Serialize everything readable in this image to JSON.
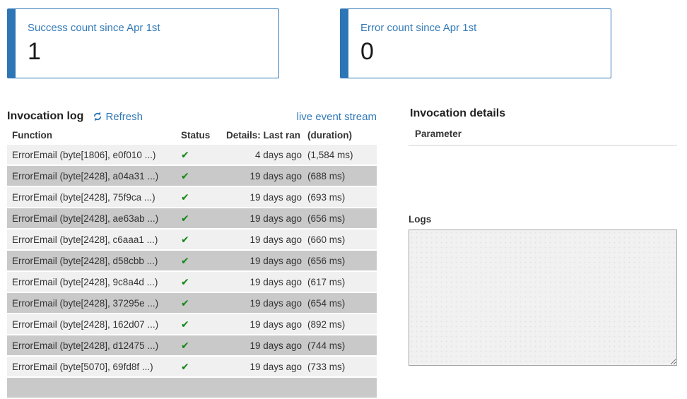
{
  "cards": [
    {
      "label": "Success count since Apr 1st",
      "value": "1"
    },
    {
      "label": "Error count since Apr 1st",
      "value": "0"
    }
  ],
  "log": {
    "title": "Invocation log",
    "refresh_label": "Refresh",
    "live_link_label": "live event stream",
    "columns": {
      "function": "Function",
      "status": "Status",
      "last_ran": "Details: Last ran",
      "duration": "(duration)"
    },
    "status_glyph": "✔",
    "rows": [
      {
        "function": "ErrorEmail (byte[1806], e0f010 ...)",
        "status": "success",
        "last_ran": "4 days ago",
        "duration": "(1,584 ms)"
      },
      {
        "function": "ErrorEmail (byte[2428], a04a31 ...)",
        "status": "success",
        "last_ran": "19 days ago",
        "duration": "(688 ms)"
      },
      {
        "function": "ErrorEmail (byte[2428], 75f9ca ...)",
        "status": "success",
        "last_ran": "19 days ago",
        "duration": "(693 ms)"
      },
      {
        "function": "ErrorEmail (byte[2428], ae63ab ...)",
        "status": "success",
        "last_ran": "19 days ago",
        "duration": "(656 ms)"
      },
      {
        "function": "ErrorEmail (byte[2428], c6aaa1 ...)",
        "status": "success",
        "last_ran": "19 days ago",
        "duration": "(660 ms)"
      },
      {
        "function": "ErrorEmail (byte[2428], d58cbb ...)",
        "status": "success",
        "last_ran": "19 days ago",
        "duration": "(656 ms)"
      },
      {
        "function": "ErrorEmail (byte[2428], 9c8a4d ...)",
        "status": "success",
        "last_ran": "19 days ago",
        "duration": "(617 ms)"
      },
      {
        "function": "ErrorEmail (byte[2428], 37295e ...)",
        "status": "success",
        "last_ran": "19 days ago",
        "duration": "(654 ms)"
      },
      {
        "function": "ErrorEmail (byte[2428], 162d07 ...)",
        "status": "success",
        "last_ran": "19 days ago",
        "duration": "(892 ms)"
      },
      {
        "function": "ErrorEmail (byte[2428], d12475 ...)",
        "status": "success",
        "last_ran": "19 days ago",
        "duration": "(744 ms)"
      },
      {
        "function": "ErrorEmail (byte[5070], 69fd8f ...)",
        "status": "success",
        "last_ran": "19 days ago",
        "duration": "(733 ms)"
      }
    ]
  },
  "details": {
    "title": "Invocation details",
    "parameter_header": "Parameter",
    "logs_label": "Logs",
    "logs_value": ""
  },
  "colors": {
    "accent_blue": "#2e75b6",
    "link_blue": "#337ab7",
    "success_green": "#148514",
    "row_light": "#f0f0f0",
    "row_dark": "#c9c9c9"
  }
}
